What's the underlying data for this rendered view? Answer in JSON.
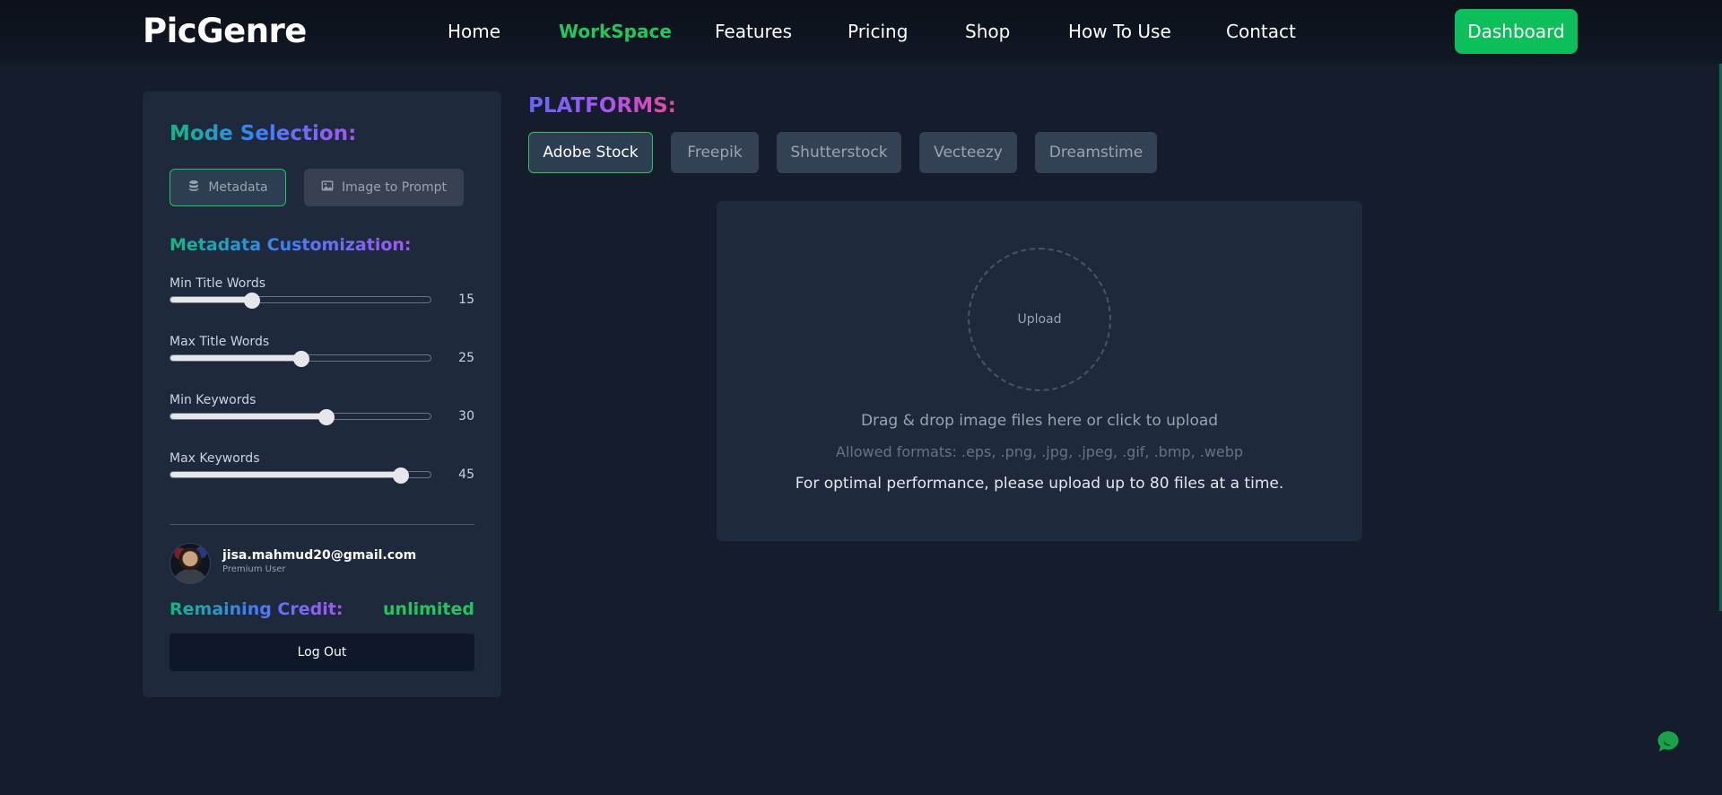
{
  "brand": {
    "name": "PicGenre"
  },
  "nav": {
    "items": [
      {
        "label": "Home",
        "active": false
      },
      {
        "label": "WorkSpace",
        "active": true
      },
      {
        "label": "Features",
        "active": false
      },
      {
        "label": "Pricing",
        "active": false
      },
      {
        "label": "Shop",
        "active": false
      },
      {
        "label": "How To Use",
        "active": false
      },
      {
        "label": "Contact",
        "active": false
      }
    ],
    "dashboard_label": "Dashboard"
  },
  "sidebar": {
    "mode_title": "Mode Selection:",
    "modes": [
      {
        "label": "Metadata",
        "icon": "database-icon",
        "selected": true
      },
      {
        "label": "Image to Prompt",
        "icon": "image-icon",
        "selected": false
      }
    ],
    "customization_title": "Metadata Customization:",
    "sliders": [
      {
        "label": "Min Title Words",
        "value": "15",
        "fraction": 0.315
      },
      {
        "label": "Max Title Words",
        "value": "25",
        "fraction": 0.505
      },
      {
        "label": "Min Keywords",
        "value": "30",
        "fraction": 0.6
      },
      {
        "label": "Max Keywords",
        "value": "45",
        "fraction": 0.885
      }
    ],
    "user": {
      "email": "jisa.mahmud20@gmail.com",
      "role": "Premium User"
    },
    "credit_label": "Remaining Credit:",
    "credit_value": "unlimited",
    "logout_label": "Log Out"
  },
  "platforms": {
    "title": "PLATFORMS:",
    "items": [
      {
        "label": "Adobe Stock",
        "active": true
      },
      {
        "label": "Freepik",
        "active": false
      },
      {
        "label": "Shutterstock",
        "active": false
      },
      {
        "label": "Vecteezy",
        "active": false
      },
      {
        "label": "Dreamstime",
        "active": false
      }
    ]
  },
  "upload": {
    "circle_label": "Upload",
    "instruction": "Drag & drop image files here or click to upload",
    "formats": "Allowed formats: .eps, .png, .jpg, .jpeg, .gif, .bmp, .webp",
    "note": "For optimal performance, please upload up to 80 files at a time."
  },
  "colors": {
    "accent_green": "#22c55e",
    "background": "#151d2c",
    "panel": "#1e293b"
  }
}
